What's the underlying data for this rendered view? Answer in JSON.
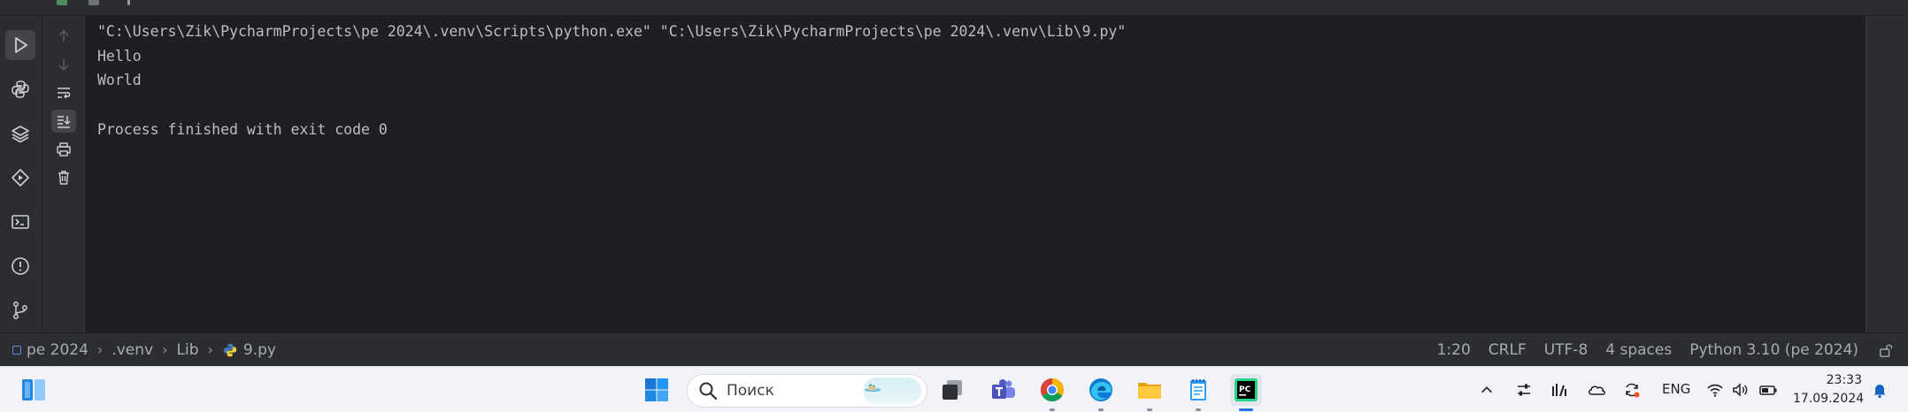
{
  "console": {
    "lines": [
      "\"C:\\Users\\Zik\\PycharmProjects\\pe 2024\\.venv\\Scripts\\python.exe\" \"C:\\Users\\Zik\\PycharmProjects\\pe 2024\\.venv\\Lib\\9.py\"",
      "Hello",
      "World",
      "",
      "Process finished with exit code 0"
    ]
  },
  "statusbar": {
    "breadcrumbs": [
      "pe 2024",
      ".venv",
      "Lib",
      "9.py"
    ],
    "position": "1:20",
    "line_separator": "CRLF",
    "encoding": "UTF-8",
    "indent": "4 spaces",
    "interpreter": "Python 3.10 (pe 2024)"
  },
  "taskbar": {
    "search_placeholder": "Поиск",
    "language": "ENG",
    "time": "23:33",
    "date": "17.09.2024"
  },
  "left_toolbar_icons": [
    "run-icon",
    "python-console-icon",
    "layers-icon",
    "services-icon",
    "terminal-icon",
    "problems-icon",
    "git-icon"
  ],
  "run_toolbar_icons": [
    "up-arrow-icon",
    "down-arrow-icon",
    "soft-wrap-icon",
    "scroll-to-end-icon",
    "print-icon",
    "trash-icon"
  ],
  "colors": {
    "ide_background": "#1e1f22",
    "panel_background": "#2b2d30",
    "console_text": "#bcbec4",
    "taskbar_background": "#f1f3f8",
    "accent": "#1a73e8"
  }
}
